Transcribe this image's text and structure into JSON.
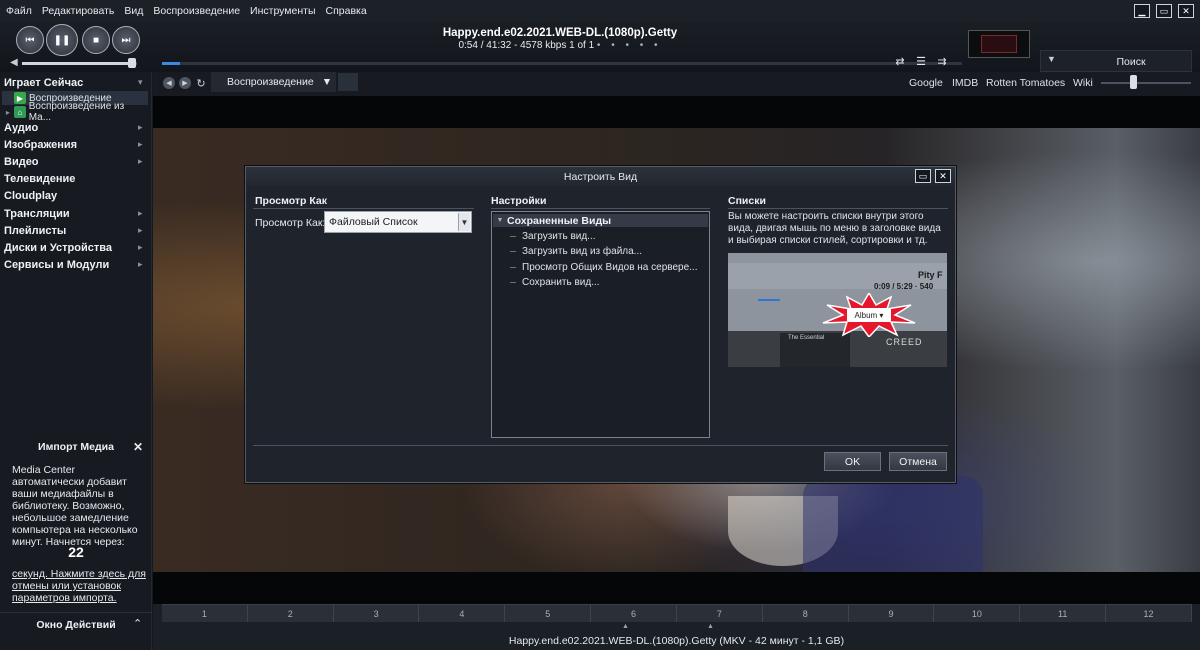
{
  "menubar": {
    "items": [
      "Файл",
      "Редактировать",
      "Вид",
      "Воспроизведение",
      "Инструменты",
      "Справка"
    ]
  },
  "window": {
    "minimize_icon": "minimize-icon",
    "maximize_icon": "maximize-icon",
    "close_icon": "close-icon"
  },
  "player": {
    "title": "Happy.end.e02.2021.WEB-DL.(1080p).Getty",
    "time": "0:54 / 41:32",
    "bitrate": "4578 kbps",
    "track": "1 of 1",
    "dots": "• • • • •",
    "seek_progress": 0.022,
    "volume": 0.92,
    "buttons": [
      "previous-icon",
      "pause-icon",
      "stop-icon",
      "next-icon"
    ]
  },
  "search": {
    "label": "Поиск"
  },
  "sidebar": {
    "now_playing": "Играет Сейчас",
    "sub_items": [
      "Воспроизведение",
      "Воспроизведение из Ма..."
    ],
    "items": [
      "Аудио",
      "Изображения",
      "Видео",
      "Телевидение",
      "Cloudplay",
      "Трансляции",
      "Плейлисты",
      "Диски и Устройства",
      "Сервисы и Модули"
    ]
  },
  "import": {
    "title": "Импорт Медиа",
    "text": "Media Center автоматически добавит ваши медиафайлы в библиотеку. Возможно, небольшое замедление компьютера на несколько минут. Начнется через:",
    "countdown": "22",
    "link": "секунд. Нажмите здесь для отмены или установок параметров импорта."
  },
  "actions": {
    "label": "Окно Действий"
  },
  "toolbar": {
    "view_label": "Воспроизведение",
    "links": [
      "Google",
      "IMDB",
      "Rotten Tomatoes",
      "Wiki"
    ],
    "zoom_level": 0.35
  },
  "chapters": {
    "labels": [
      "1",
      "2",
      "3",
      "4",
      "5",
      "6",
      "7",
      "8",
      "9",
      "10",
      "11",
      "12"
    ],
    "file_info": "Happy.end.e02.2021.WEB-DL.(1080p).Getty (MKV - 42 минут - 1,1 GB)"
  },
  "dialog": {
    "title": "Настроить Вид",
    "view_as_heading": "Просмотр Как",
    "view_as_label": "Просмотр Как:",
    "view_as_value": "Файловый Список",
    "settings_heading": "Настройки",
    "tree_head": "Сохраненные Виды",
    "tree_items": [
      "Загрузить вид...",
      "Загрузить вид из файла...",
      "Просмотр Общих Видов на сервере...",
      "Сохранить вид..."
    ],
    "lists_heading": "Списки",
    "lists_text": "Вы можете настроить списки внутри этого вида, двигая мышь по меню в заголовке вида и выбирая списки стилей, сортировки и тд.",
    "preview": {
      "artist": "Pity F",
      "time": "0:09 / 5:29 · 540",
      "album_badge": "Album ▾",
      "cover_left": "The Essential",
      "cover_right": "CREED"
    },
    "ok": "OK",
    "cancel": "Отмена"
  }
}
